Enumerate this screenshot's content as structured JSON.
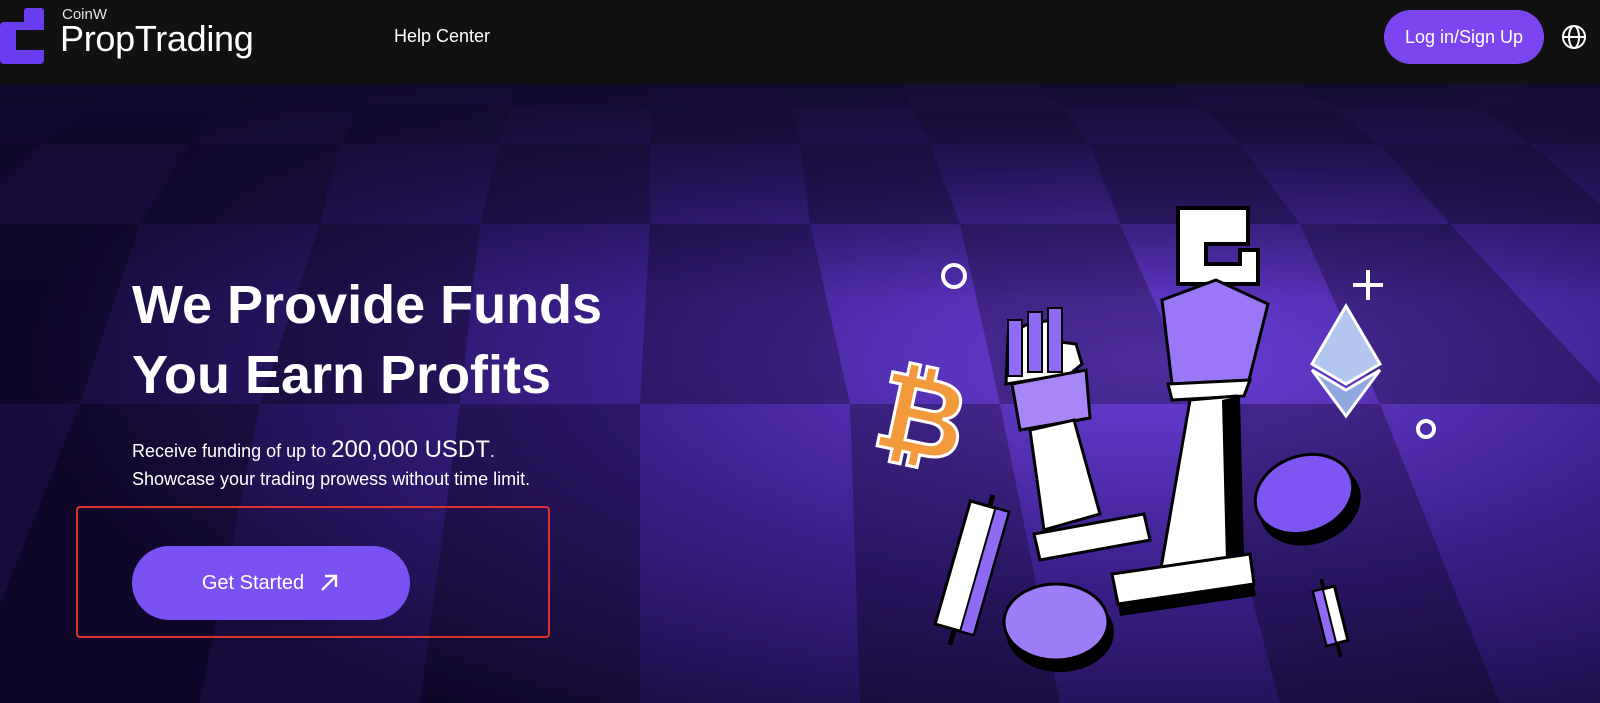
{
  "header": {
    "brand_small": "CoinW",
    "brand_big": "PropTrading",
    "nav_help": "Help Center",
    "login_label": "Log in/Sign Up",
    "globe_icon": "globe-icon",
    "logo_icon": "coinw-logo-icon"
  },
  "hero": {
    "headline_line1": "We Provide Funds",
    "headline_line2": "You Earn Profits",
    "sub_line1_prefix": "Receive funding of up to",
    "sub_amount": "200,000 USDT",
    "sub_line1_suffix": ".",
    "sub_line2": "Showcase your trading prowess without time limit.",
    "cta_label": "Get Started",
    "cta_icon": "arrow-up-right-icon"
  },
  "colors": {
    "accent": "#7b45f0",
    "highlight_box": "#e0302a",
    "topbar_bg": "#111111",
    "hero_purple": "#3a1f86",
    "bitcoin_orange": "#f39a3c"
  }
}
